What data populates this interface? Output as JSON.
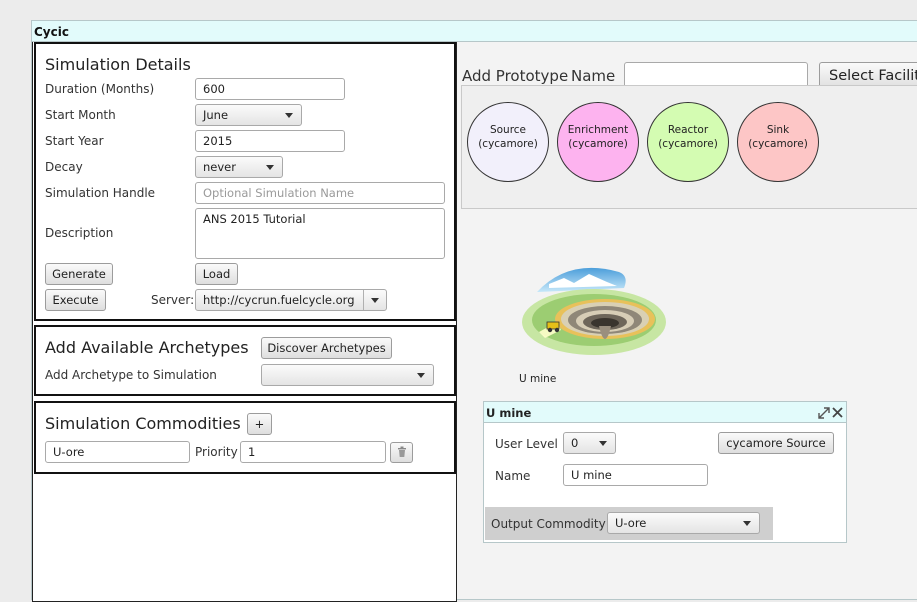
{
  "window": {
    "title": "Cycic"
  },
  "simulation_details": {
    "heading": "Simulation Details",
    "duration_label": "Duration (Months)",
    "duration_value": "600",
    "start_month_label": "Start Month",
    "start_month_value": "June",
    "start_year_label": "Start Year",
    "start_year_value": "2015",
    "decay_label": "Decay",
    "decay_value": "never",
    "handle_label": "Simulation Handle",
    "handle_placeholder": "Optional Simulation Name",
    "description_label": "Description",
    "description_value": "ANS 2015 Tutorial",
    "generate_label": "Generate",
    "load_label": "Load",
    "execute_label": "Execute",
    "server_label": "Server:",
    "server_value": "http://cycrun.fuelcycle.org"
  },
  "archetypes": {
    "heading": "Add Available Archetypes",
    "discover_label": "Discover Archetypes",
    "add_label": "Add Archetype to Simulation",
    "add_value": ""
  },
  "commodities": {
    "heading": "Simulation Commodities",
    "add_label": "+",
    "name_value": "U-ore",
    "priority_label": "Priority",
    "priority_value": "1"
  },
  "prototype": {
    "heading": "Add Prototype",
    "name_label": "Name",
    "name_value": "",
    "select_label": "Select Facilit",
    "facilities": [
      {
        "name": "Source",
        "lib": "(cycamore)",
        "color": "#f2f0fb"
      },
      {
        "name": "Enrichment",
        "lib": "(cycamore)",
        "color": "#fdb3ef"
      },
      {
        "name": "Reactor",
        "lib": "(cycamore)",
        "color": "#d4fcb2"
      },
      {
        "name": "Sink",
        "lib": "(cycamore)",
        "color": "#fdc6c6"
      }
    ]
  },
  "canvas": {
    "node_label": "U mine"
  },
  "facility_window": {
    "title": "U mine",
    "user_level_label": "User Level",
    "user_level_value": "0",
    "type_label": "cycamore Source",
    "name_label": "Name",
    "name_value": "U mine",
    "output_label": "Output Commodity",
    "output_value": "U-ore"
  }
}
